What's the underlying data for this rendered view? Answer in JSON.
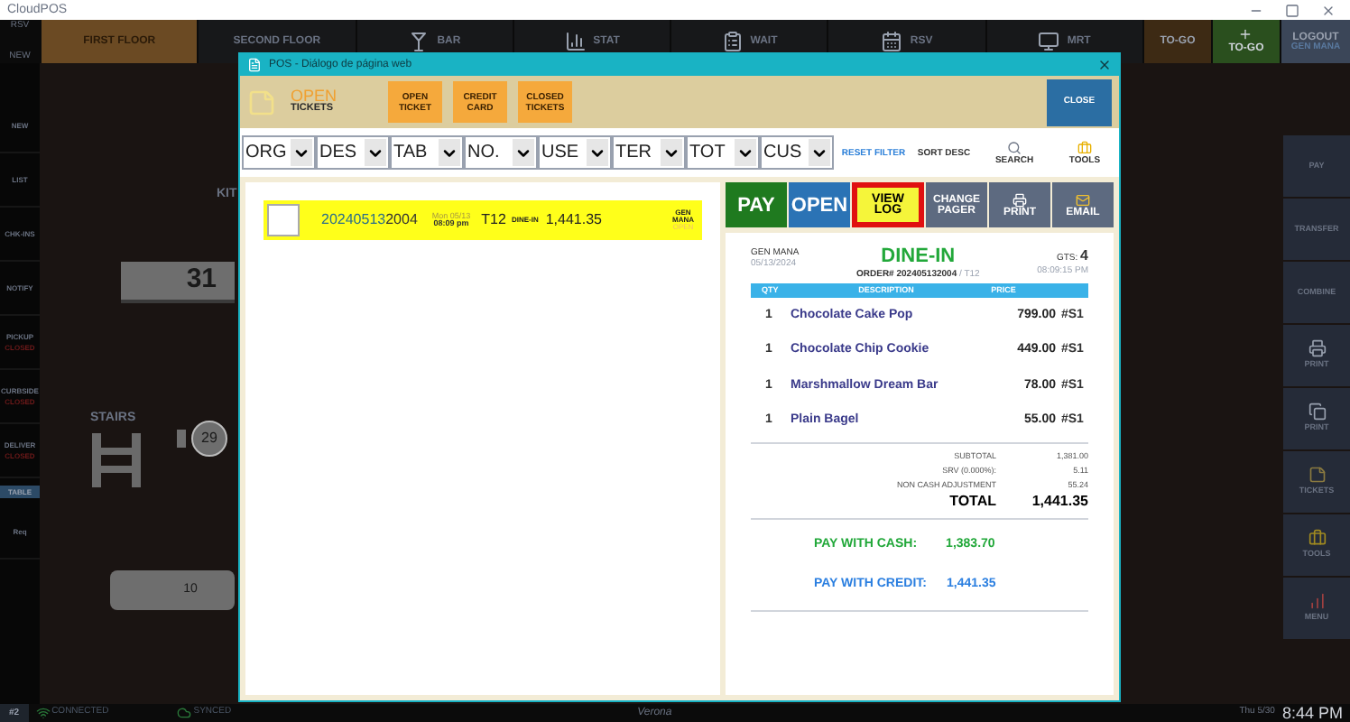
{
  "app_title": "CloudPOS",
  "top_left": [
    "RSV",
    "NEW"
  ],
  "nav_tabs": [
    {
      "label": "FIRST FLOOR",
      "kind": "plain",
      "selected": true
    },
    {
      "label": "SECOND FLOOR",
      "kind": "plain",
      "selected": false
    },
    {
      "label": "BAR",
      "kind": "bar",
      "selected": false
    },
    {
      "label": "STAT",
      "kind": "stats",
      "selected": false
    },
    {
      "label": "WAIT",
      "kind": "waitlist",
      "selected": false
    },
    {
      "label": "RSV",
      "kind": "reservations",
      "selected": false
    },
    {
      "label": "MRT",
      "kind": "monitor",
      "selected": false
    }
  ],
  "to_go": [
    {
      "label": "TO-GO",
      "kind": "plain"
    },
    {
      "label": "TO-GO",
      "kind": "add"
    }
  ],
  "logout": {
    "label": "LOGOUT",
    "user": "GEN MANA"
  },
  "sidebar": [
    {
      "label": "NEW",
      "kind": "item"
    },
    {
      "label": "LIST",
      "kind": "item"
    },
    {
      "label": "CHK-INS",
      "kind": "item"
    },
    {
      "label": "NOTIFY",
      "kind": "item"
    },
    {
      "label": "PICKUP",
      "kind": "item",
      "status": "CLOSED"
    },
    {
      "label": "CURBSIDE",
      "kind": "item",
      "status": "CLOSED"
    },
    {
      "label": "DELIVER",
      "kind": "item",
      "status": "CLOSED"
    },
    {
      "label": "TABLE",
      "kind": "tag"
    },
    {
      "label": "Req",
      "kind": "item"
    }
  ],
  "floor": {
    "kitchen_label": "KIT",
    "stairs_label": "STAIRS",
    "tables": [
      {
        "number": "31",
        "kind": "rect"
      },
      {
        "number": "29",
        "kind": "round"
      },
      {
        "number": "10",
        "kind": "flat"
      }
    ]
  },
  "right_actions": [
    {
      "label": "PAY",
      "kind": "plain"
    },
    {
      "label": "TRANSFER",
      "kind": "plain"
    },
    {
      "label": "COMBINE",
      "kind": "plain"
    },
    {
      "label": "PRINT",
      "kind": "print"
    },
    {
      "label": "PRINT",
      "kind": "print_all"
    },
    {
      "label": "TICKETS",
      "kind": "tickets"
    },
    {
      "label": "TOOLS",
      "kind": "tools"
    },
    {
      "label": "MENU",
      "kind": "menu"
    }
  ],
  "status_bar": {
    "station": "#2",
    "connection": "CONNECTED",
    "sync": "SYNCED",
    "location": "Verona",
    "date": "Thu 5/30",
    "time": "8:44 PM"
  },
  "dialog": {
    "title": "POS - Diálogo de página web",
    "header": {
      "title": "OPEN",
      "subtitle": "TICKETS",
      "buttons": [
        "OPEN TICKET",
        "CREDIT CARD",
        "CLOSED TICKETS"
      ],
      "close": "CLOSE"
    },
    "filters": [
      "ORG",
      "DES",
      "TAB",
      "NO.",
      "USE",
      "TER",
      "TOT",
      "CUS"
    ],
    "filter_actions": [
      {
        "label": "RESET FILTER",
        "kind": "reset"
      },
      {
        "label": "SORT DESC",
        "kind": "sort"
      },
      {
        "label": "SEARCH",
        "kind": "search"
      },
      {
        "label": "TOOLS",
        "kind": "tools"
      }
    ],
    "tickets": [
      {
        "selected": true,
        "checked": false,
        "order_prefix": "20240513",
        "order_suffix": "2004",
        "day": "Mon 05/13",
        "time": "08:09 pm",
        "table": "T12",
        "type": "DINE-IN",
        "total": "1,441.35",
        "user": "GEN MANA",
        "status": "OPEN"
      }
    ],
    "actions": [
      {
        "label": "PAY",
        "kind": "pay",
        "highlighted": false
      },
      {
        "label": "OPEN",
        "kind": "open",
        "highlighted": false
      },
      {
        "label": "VIEW LOG",
        "kind": "log",
        "highlighted": true
      },
      {
        "label": "CHANGE PAGER",
        "kind": "plain",
        "highlighted": false
      },
      {
        "label": "PRINT",
        "kind": "print",
        "highlighted": false
      },
      {
        "label": "EMAIL",
        "kind": "email",
        "highlighted": false
      }
    ],
    "receipt": {
      "user": "GEN MANA",
      "date": "05/13/2024",
      "type": "DINE-IN",
      "order": "ORDER# 202405132004",
      "table": "/ T12",
      "guests_label": "GTS:",
      "guests": "4",
      "time": "08:09:15 PM",
      "columns": [
        "QTY",
        "DESCRIPTION",
        "PRICE"
      ],
      "items": [
        {
          "qty": "1",
          "name": "Chocolate Cake Pop",
          "price": "799.00",
          "seat": "#S1"
        },
        {
          "qty": "1",
          "name": "Chocolate Chip Cookie",
          "price": "449.00",
          "seat": "#S1"
        },
        {
          "qty": "1",
          "name": "Marshmallow Dream Bar",
          "price": "78.00",
          "seat": "#S1"
        },
        {
          "qty": "1",
          "name": "Plain Bagel",
          "price": "55.00",
          "seat": "#S1"
        }
      ],
      "totals": [
        {
          "label": "SUBTOTAL",
          "value": "1,381.00"
        },
        {
          "label": "SRV (0.000%):",
          "value": "5.11"
        },
        {
          "label": "NON CASH ADJUSTMENT",
          "value": "55.24"
        }
      ],
      "total": {
        "label": "TOTAL",
        "value": "1,441.35"
      },
      "pay_cash": {
        "label": "PAY WITH CASH:",
        "value": "1,383.70"
      },
      "pay_credit": {
        "label": "PAY WITH CREDIT:",
        "value": "1,441.35"
      }
    }
  }
}
